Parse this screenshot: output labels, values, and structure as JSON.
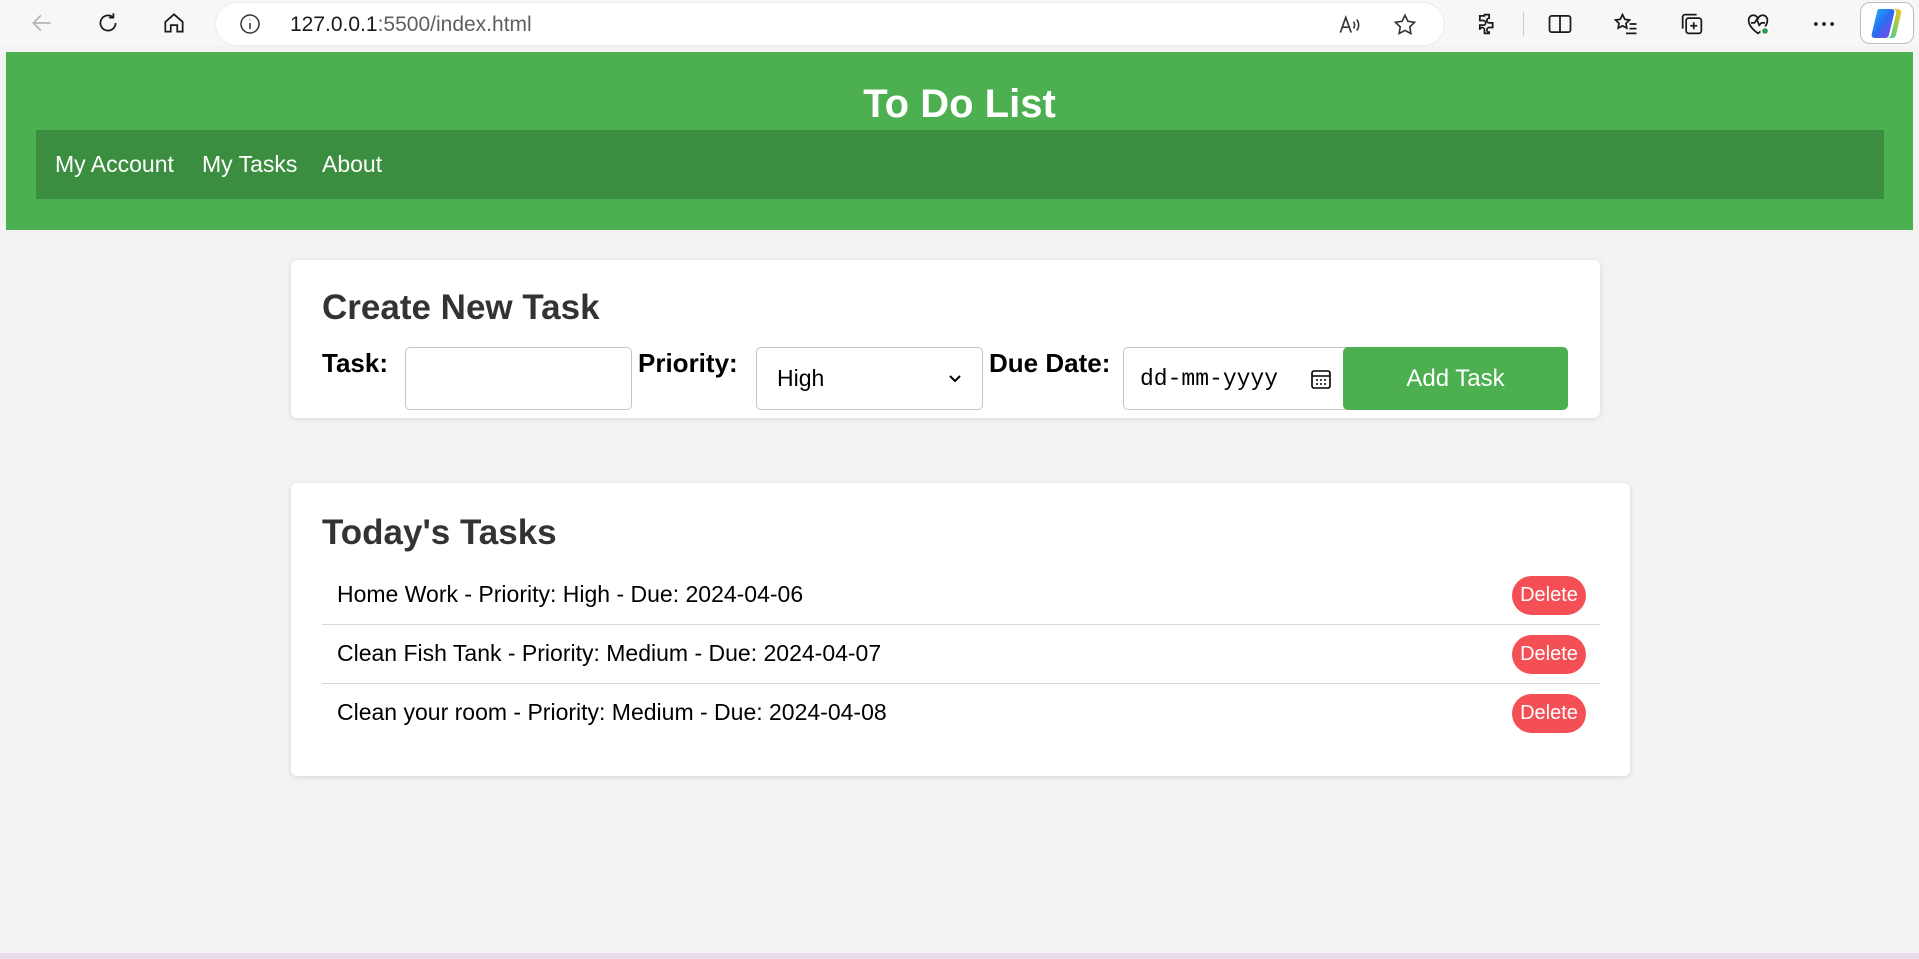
{
  "browser": {
    "url_host": "127.0.0.1",
    "url_rest": ":5500/index.html"
  },
  "header": {
    "title": "To Do List",
    "nav": [
      "My Account",
      "My Tasks",
      "About"
    ],
    "bg_color": "#4caf50",
    "nav_color": "#3b8e40"
  },
  "create_task": {
    "heading": "Create New Task",
    "task_label": "Task:",
    "task_value": "",
    "priority_label": "Priority:",
    "priority_value": "High",
    "due_label": "Due Date:",
    "due_placeholder": "dd-mm-yyyy",
    "add_button": "Add Task"
  },
  "tasks": {
    "heading": "Today's Tasks",
    "delete_label": "Delete",
    "delete_color": "#f44f55",
    "items": [
      "Home Work - Priority: High - Due: 2024-04-06",
      "Clean Fish Tank - Priority: Medium - Due: 2024-04-07",
      "Clean your room - Priority: Medium - Due: 2024-04-08"
    ]
  }
}
